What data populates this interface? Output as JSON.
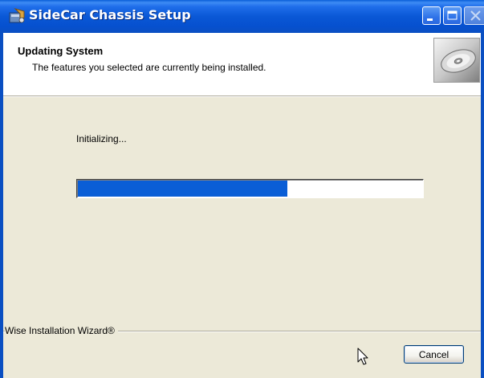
{
  "window": {
    "title": "SideCar Chassis Setup",
    "title_bar_color": "#0A58D6"
  },
  "header": {
    "title": "Updating System",
    "subtitle": "The features you selected are currently being installed.",
    "image_icon": "cd-disc-icon"
  },
  "status": {
    "text": "Initializing...",
    "progress_percent": 61,
    "progress_color": "#0A5ED6"
  },
  "branding": {
    "text": "Wise Installation Wizard®"
  },
  "buttons": {
    "cancel_label": "Cancel"
  },
  "icons": {
    "app": "installer-package-icon",
    "minimize": "minimize-icon",
    "maximize": "maximize-icon",
    "close": "close-icon",
    "cursor": "mouse-pointer-icon"
  }
}
